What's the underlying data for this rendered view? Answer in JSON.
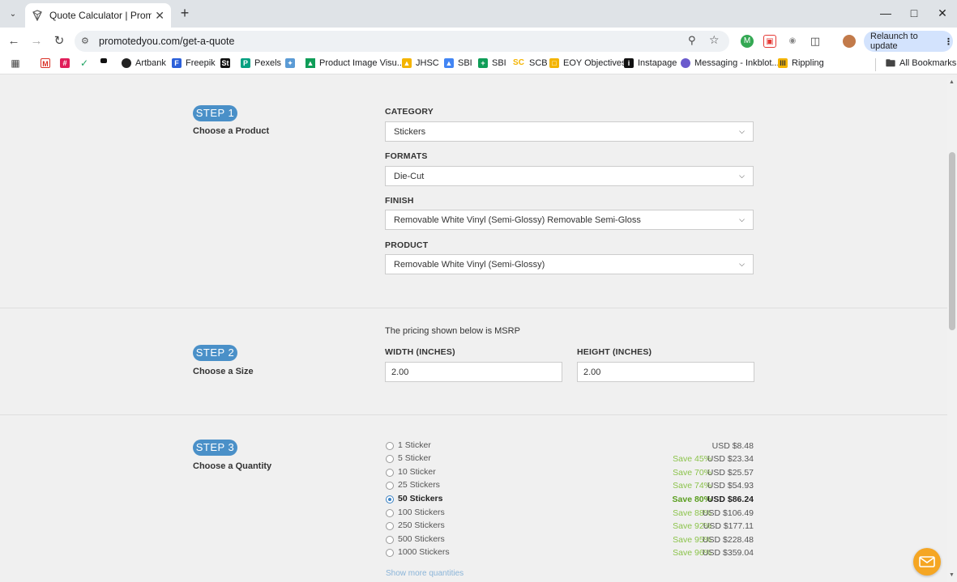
{
  "browser": {
    "tab_title": "Quote Calculator | Promoted Yo",
    "url": "promotedyou.com/get-a-quote",
    "relaunch_label": "Relaunch to update",
    "bookmarks": [
      "Artbank",
      "Freepik",
      "Pexels",
      "Product Image Visu...",
      "JHSC",
      "SBI",
      "SBI",
      "SCB",
      "EOY Objectives",
      "Instapage",
      "Messaging - Inkblot...",
      "Rippling"
    ],
    "all_bookmarks_label": "All Bookmarks"
  },
  "step1": {
    "badge": "STEP 1",
    "subtitle": "Choose a Product",
    "category_label": "CATEGORY",
    "category_value": "Stickers",
    "formats_label": "FORMATS",
    "formats_value": "Die-Cut",
    "finish_label": "FINISH",
    "finish_value": "Removable White Vinyl (Semi-Glossy) Removable Semi-Gloss",
    "product_label": "PRODUCT",
    "product_value": "Removable White Vinyl (Semi-Glossy)"
  },
  "step2": {
    "badge": "STEP 2",
    "subtitle": "Choose a Size",
    "note": "The pricing shown below is MSRP",
    "width_label": "WIDTH (INCHES)",
    "width_value": "2.00",
    "height_label": "HEIGHT (INCHES)",
    "height_value": "2.00"
  },
  "step3": {
    "badge": "STEP 3",
    "subtitle": "Choose a Quantity",
    "selected_index": 4,
    "quantities": [
      {
        "label": "1 Sticker",
        "save": "",
        "price": "USD $8.48"
      },
      {
        "label": "5 Sticker",
        "save": "Save 45%",
        "price": "USD $23.34"
      },
      {
        "label": "10 Sticker",
        "save": "Save 70%",
        "price": "USD $25.57"
      },
      {
        "label": "25 Stickers",
        "save": "Save 74%",
        "price": "USD $54.93"
      },
      {
        "label": "50 Stickers",
        "save": "Save 80%",
        "price": "USD $86.24"
      },
      {
        "label": "100 Stickers",
        "save": "Save 88%",
        "price": "USD $106.49"
      },
      {
        "label": "250 Stickers",
        "save": "Save 92%",
        "price": "USD $177.11"
      },
      {
        "label": "500 Stickers",
        "save": "Save 95%",
        "price": "USD $228.48"
      },
      {
        "label": "1000 Stickers",
        "save": "Save 96%",
        "price": "USD $359.04"
      }
    ],
    "show_more": "Show more quantities"
  },
  "colors": {
    "step_badge": "#4a90c8",
    "save_green": "#8bc34a",
    "chat_button": "#f5a623"
  }
}
